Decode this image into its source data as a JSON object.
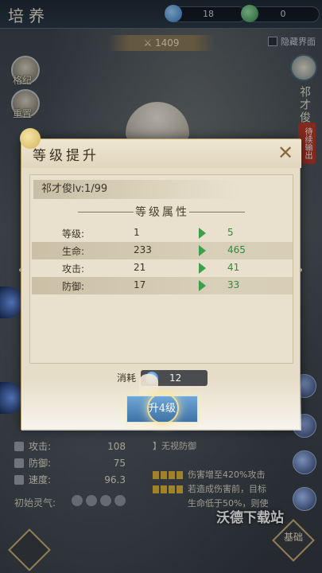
{
  "topbar": {
    "title": "培养",
    "currency_blue": "18",
    "currency_green": "0"
  },
  "power": "1409",
  "hide_ui_label": "隐藏界面",
  "side": {
    "left1": "格纪",
    "left2": "重置",
    "hero_name": "祁才俊",
    "tag": "待续输出"
  },
  "dialog": {
    "title": "等级提升",
    "close": "✕",
    "character_line": "祁才俊lv:1/99",
    "section_title": "等级属性",
    "attributes": [
      {
        "name": "等级:",
        "from": "1",
        "to": "5"
      },
      {
        "name": "生命:",
        "from": "233",
        "to": "465"
      },
      {
        "name": "攻击:",
        "from": "21",
        "to": "41"
      },
      {
        "name": "防御:",
        "from": "17",
        "to": "33"
      }
    ],
    "cost_label": "消耗",
    "cost_value": "12",
    "upgrade_button": "升4级"
  },
  "stats": [
    {
      "label": "攻击:",
      "value": "108"
    },
    {
      "label": "防御:",
      "value": "75"
    },
    {
      "label": "速度:",
      "value": "96.3"
    }
  ],
  "initial_qi": "初始灵气:",
  "skill": {
    "line1": "】无视防御",
    "line2": "伤害增至420%攻击",
    "line3": "若造成伤害前，目标",
    "line4": "生命低于50%，则使"
  },
  "watermark": "沃德下载站",
  "corner_right": "基础",
  "colors": {
    "accent_gold": "#c9b17a",
    "green_value": "#2c8c3c",
    "button_blue": "#4f88bd"
  }
}
